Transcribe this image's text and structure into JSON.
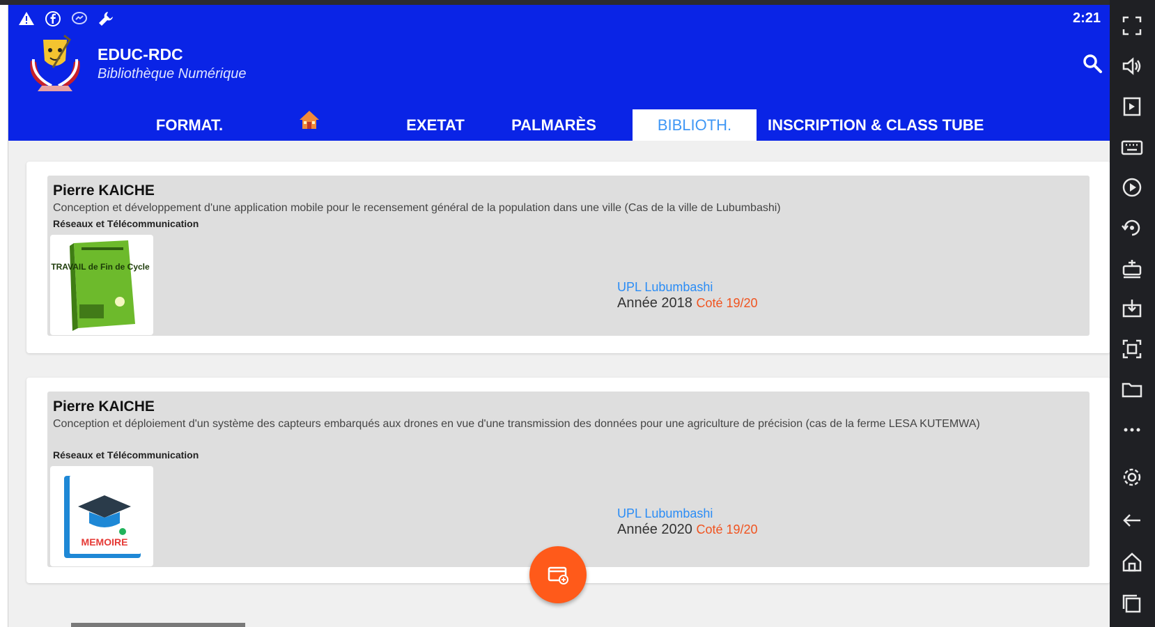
{
  "status_bar": {
    "time": "2:21",
    "icons": [
      "warning-icon",
      "facebook-icon",
      "messenger-icon",
      "wrench-icon"
    ]
  },
  "app": {
    "title": "EDUC-RDC",
    "subtitle": "Bibliothèque Numérique",
    "logo_icon": "coat-of-arms-icon",
    "search_icon": "search-icon"
  },
  "tabs": [
    {
      "label": "FORMAT."
    },
    {
      "label": "",
      "icon": "home-icon"
    },
    {
      "label": "EXETAT"
    },
    {
      "label": "PALMARÈS"
    },
    {
      "label": "BIBLIOTH.",
      "active": true
    },
    {
      "label": "INSCRIPTION & CLASS TUBE"
    }
  ],
  "entries": [
    {
      "author": "Pierre KAICHE",
      "description": "Conception et développement d'une application mobile pour le recensement général de la population dans une ville (Cas de la ville de Lubumbashi)",
      "field": "Réseaux et Télécommunication",
      "thumbnail_icon": "green-book-icon",
      "book_text": "TRAVAIL de Fin de Cycle",
      "institution": "UPL Lubumbashi",
      "year": "Année 2018",
      "grade": "Coté 19/20"
    },
    {
      "author": "Pierre KAICHE",
      "description": "Conception et déploiement d'un système des capteurs embarqués aux drones en vue d'une transmission des données pour une agriculture de précision (cas de la ferme LESA KUTEMWA)",
      "field": "Réseaux et Télécommunication",
      "thumbnail_icon": "memoire-book-icon",
      "book_text": "MEMOIRE",
      "institution": "UPL Lubumbashi",
      "year": "Année 2020",
      "grade": "Coté 19/20"
    }
  ],
  "fab_icon": "add-document-icon",
  "emulator_sidebar": [
    "fullscreen-icon",
    "volume-icon",
    "screen-record-icon",
    "keyboard-icon",
    "play-icon",
    "rotate-icon",
    "shake-icon",
    "install-apk-icon",
    "screenshot-icon",
    "folder-icon",
    "more-icon",
    "settings-icon",
    "back-icon",
    "home-icon",
    "recent-apps-icon"
  ],
  "colors": {
    "header": "#0a24e6",
    "active_tab_text": "#3f97f5",
    "institution": "#2a8cf5",
    "grade": "#f0531f",
    "fab": "#ff5a1a"
  }
}
